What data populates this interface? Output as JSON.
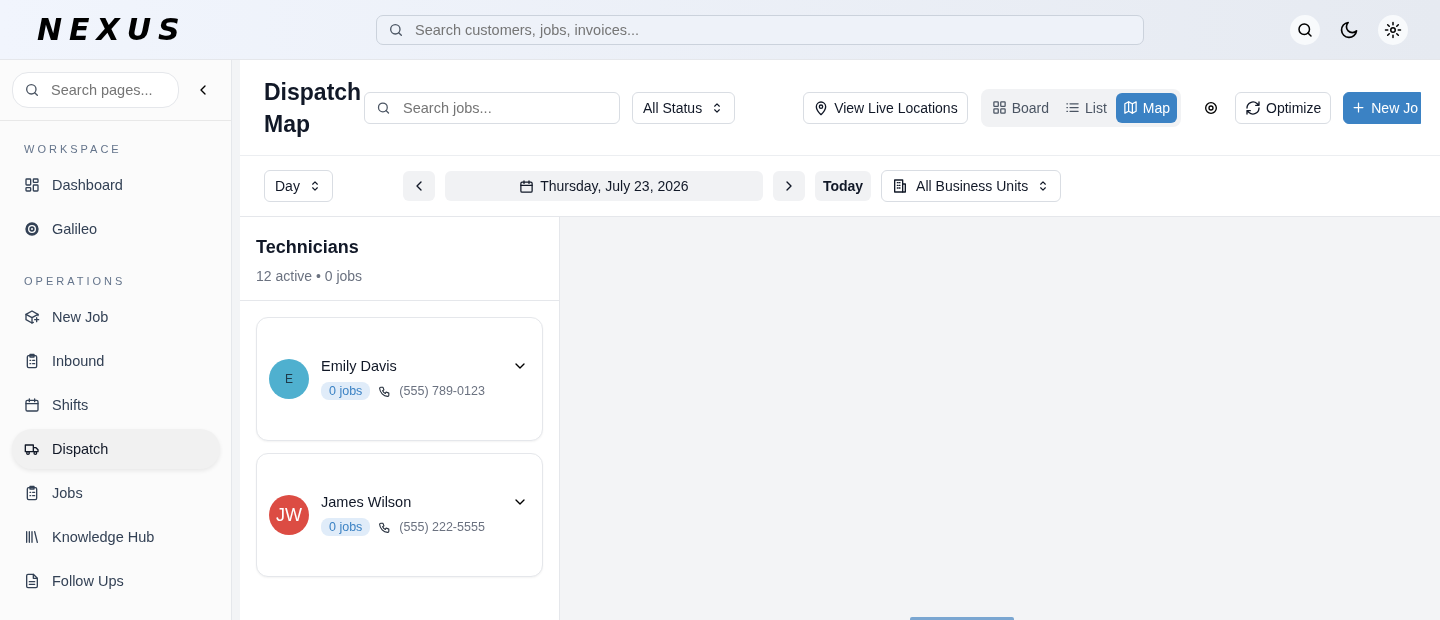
{
  "header": {
    "logo": "NEXUS",
    "search": {
      "placeholder": "Search customers, jobs, invoices..."
    }
  },
  "sidebar": {
    "search": {
      "placeholder": "Search pages..."
    },
    "sections": [
      {
        "title": "WORKSPACE",
        "items": [
          {
            "label": "Dashboard",
            "selected": false
          },
          {
            "label": "Galileo",
            "selected": false
          }
        ]
      },
      {
        "title": "OPERATIONS",
        "items": [
          {
            "label": "New Job",
            "selected": false
          },
          {
            "label": "Inbound",
            "selected": false
          },
          {
            "label": "Shifts",
            "selected": false
          },
          {
            "label": "Dispatch",
            "selected": true
          },
          {
            "label": "Jobs",
            "selected": false
          },
          {
            "label": "Knowledge Hub",
            "selected": false
          },
          {
            "label": "Follow Ups",
            "selected": false
          }
        ]
      }
    ]
  },
  "page": {
    "title": "Dispatch Map",
    "search": {
      "placeholder": "Search jobs..."
    },
    "status_filter": "All Status",
    "live_button": "View Live Locations",
    "views": [
      {
        "label": "Board",
        "selected": false
      },
      {
        "label": "List",
        "selected": false
      },
      {
        "label": "Map",
        "selected": true
      }
    ],
    "optimize_button": "Optimize",
    "new_button": "New Jo",
    "range": "Day",
    "date": "Thursday, July 23, 2026",
    "today_button": "Today",
    "units": "All Business Units"
  },
  "technicians": {
    "title": "Technicians",
    "summary": "12 active • 0 jobs",
    "items": [
      {
        "initials": "E",
        "name": "Emily Davis",
        "jobs": "0 jobs",
        "phone": "(555) 789-0123",
        "color": "#4fb0cf"
      },
      {
        "initials": "JW",
        "name": "James Wilson",
        "jobs": "0 jobs",
        "phone": "(555) 222-5555",
        "color": "#dc4c43"
      }
    ]
  }
}
